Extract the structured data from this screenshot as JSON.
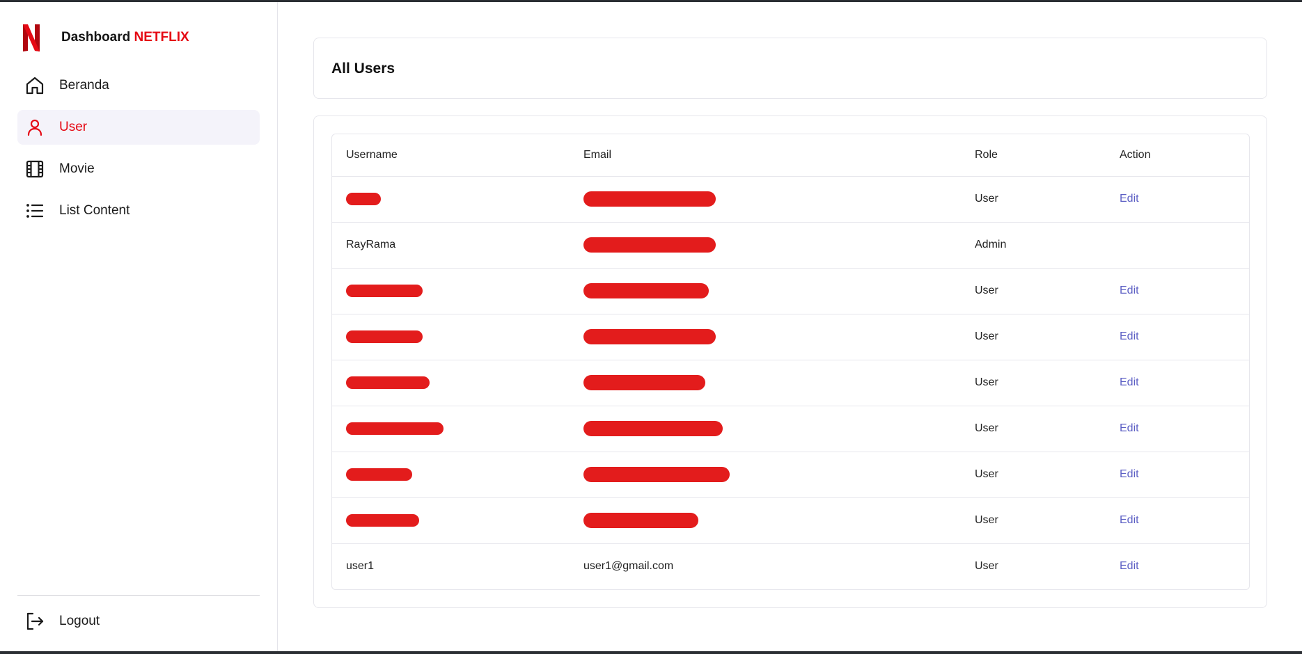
{
  "brand": {
    "name": "Dashboard",
    "accent": "NETFLIX",
    "accent_color": "#e50914",
    "logo_icon": "netflix-logo"
  },
  "sidebar": {
    "items": [
      {
        "label": "Beranda",
        "icon": "home-icon",
        "active": false
      },
      {
        "label": "User",
        "icon": "user-icon",
        "active": true
      },
      {
        "label": "Movie",
        "icon": "film-icon",
        "active": false
      },
      {
        "label": "List Content",
        "icon": "list-icon",
        "active": false
      }
    ],
    "logout": {
      "label": "Logout",
      "icon": "logout-icon"
    }
  },
  "main": {
    "title": "All Users",
    "table": {
      "headers": [
        "Username",
        "Email",
        "Role",
        "Action"
      ],
      "rows": [
        {
          "username": "",
          "email": "",
          "role": "User",
          "action": "Edit",
          "username_redacted": true,
          "email_redacted": true
        },
        {
          "username": "RayRama",
          "email": "",
          "role": "Admin",
          "action": "",
          "username_redacted": false,
          "email_redacted": true
        },
        {
          "username": "",
          "email": "",
          "role": "User",
          "action": "Edit",
          "username_redacted": true,
          "email_redacted": true
        },
        {
          "username": "",
          "email": "",
          "role": "User",
          "action": "Edit",
          "username_redacted": true,
          "email_redacted": true
        },
        {
          "username": "",
          "email": "",
          "role": "User",
          "action": "Edit",
          "username_redacted": true,
          "email_redacted": true
        },
        {
          "username": "",
          "email": "",
          "role": "User",
          "action": "Edit",
          "username_redacted": true,
          "email_redacted": true
        },
        {
          "username": "",
          "email": "",
          "role": "User",
          "action": "Edit",
          "username_redacted": true,
          "email_redacted": true
        },
        {
          "username": "",
          "email": "",
          "role": "User",
          "action": "Edit",
          "username_redacted": true,
          "email_redacted": true
        },
        {
          "username": "user1",
          "email": "user1@gmail.com",
          "role": "User",
          "action": "Edit",
          "username_redacted": false,
          "email_redacted": false
        }
      ]
    }
  },
  "colors": {
    "accent": "#e50914",
    "redaction": "#e31c1c",
    "link": "#5c5fc4",
    "active_nav_bg": "#f4f3fa"
  }
}
